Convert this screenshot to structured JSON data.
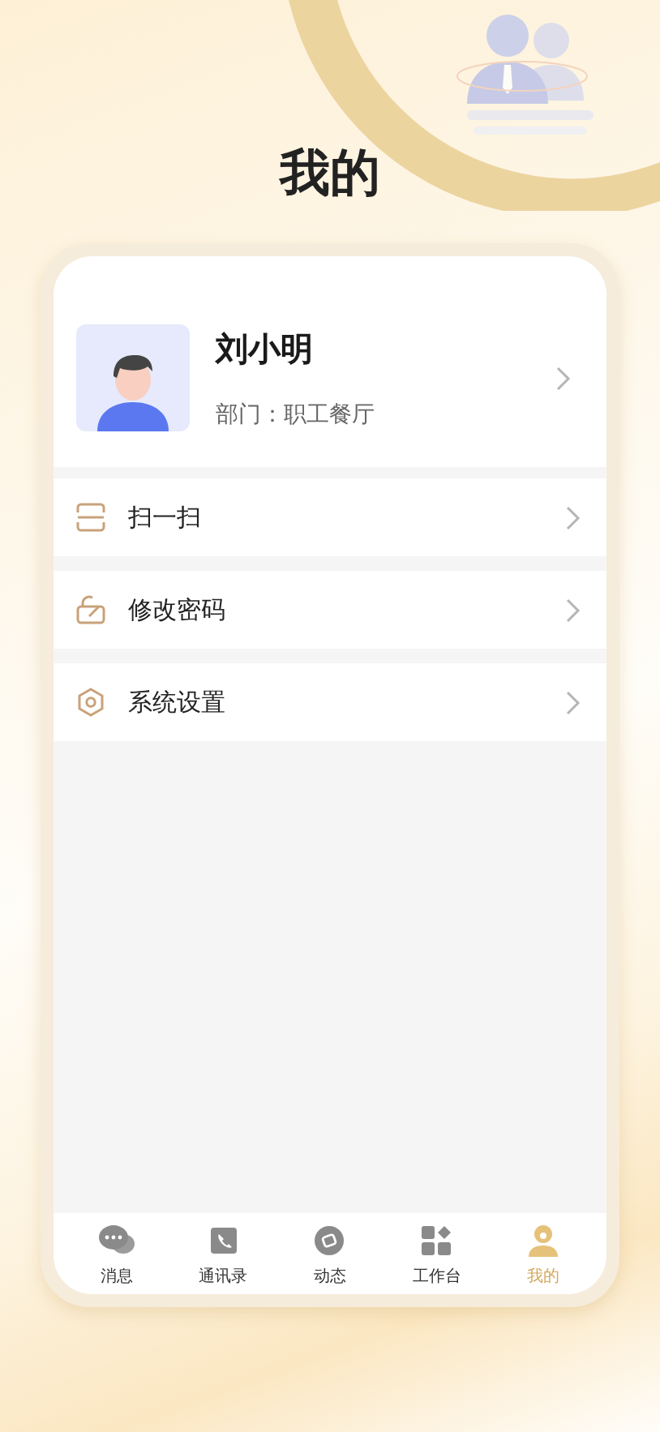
{
  "page_title": "我的",
  "profile": {
    "name": "刘小明",
    "department": "部门：职工餐厅"
  },
  "menu": [
    {
      "kind": "scan",
      "label": "扫一扫"
    },
    {
      "kind": "password",
      "label": "修改密码"
    },
    {
      "kind": "settings",
      "label": "系统设置"
    }
  ],
  "tabs": [
    {
      "kind": "chat",
      "label": "消息",
      "selected": false
    },
    {
      "kind": "contacts",
      "label": "通讯录",
      "selected": false
    },
    {
      "kind": "feed",
      "label": "动态",
      "selected": false
    },
    {
      "kind": "workbench",
      "label": "工作台",
      "selected": false
    },
    {
      "kind": "me",
      "label": "我的",
      "selected": true
    }
  ]
}
